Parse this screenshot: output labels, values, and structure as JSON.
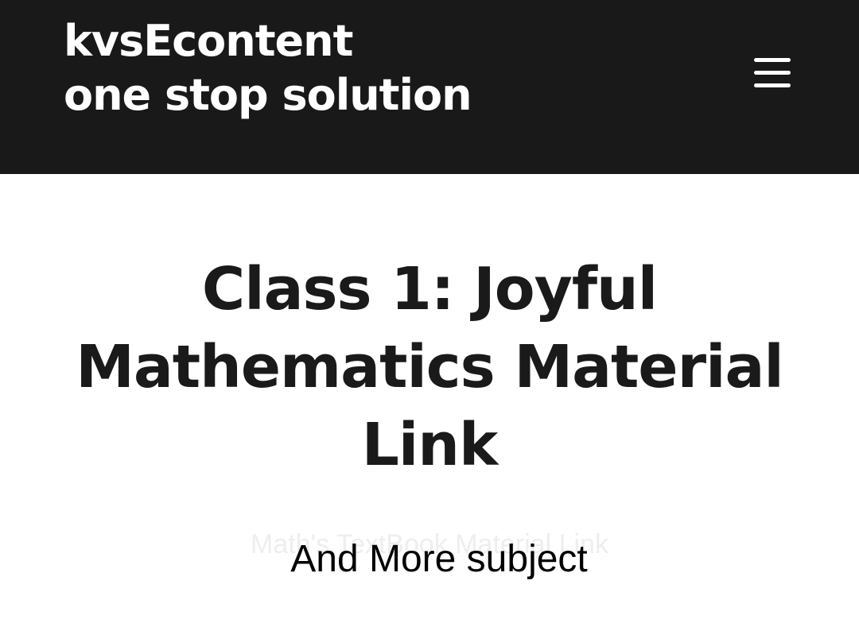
{
  "header": {
    "title_line1": "kvsEcontent",
    "title_line2": "one stop solution",
    "menu_icon": "hamburger-menu-icon",
    "background_color": "#191919",
    "text_color": "#ffffff"
  },
  "hero": {
    "title_line1": "Class 1: Joyful",
    "title_line2": "Mathematics Material",
    "title_line3": "Link",
    "subtitle": "Math's TextBook Material Link",
    "title_color": "#1a1a1a"
  },
  "overlay": {
    "caption": "And More subject"
  }
}
